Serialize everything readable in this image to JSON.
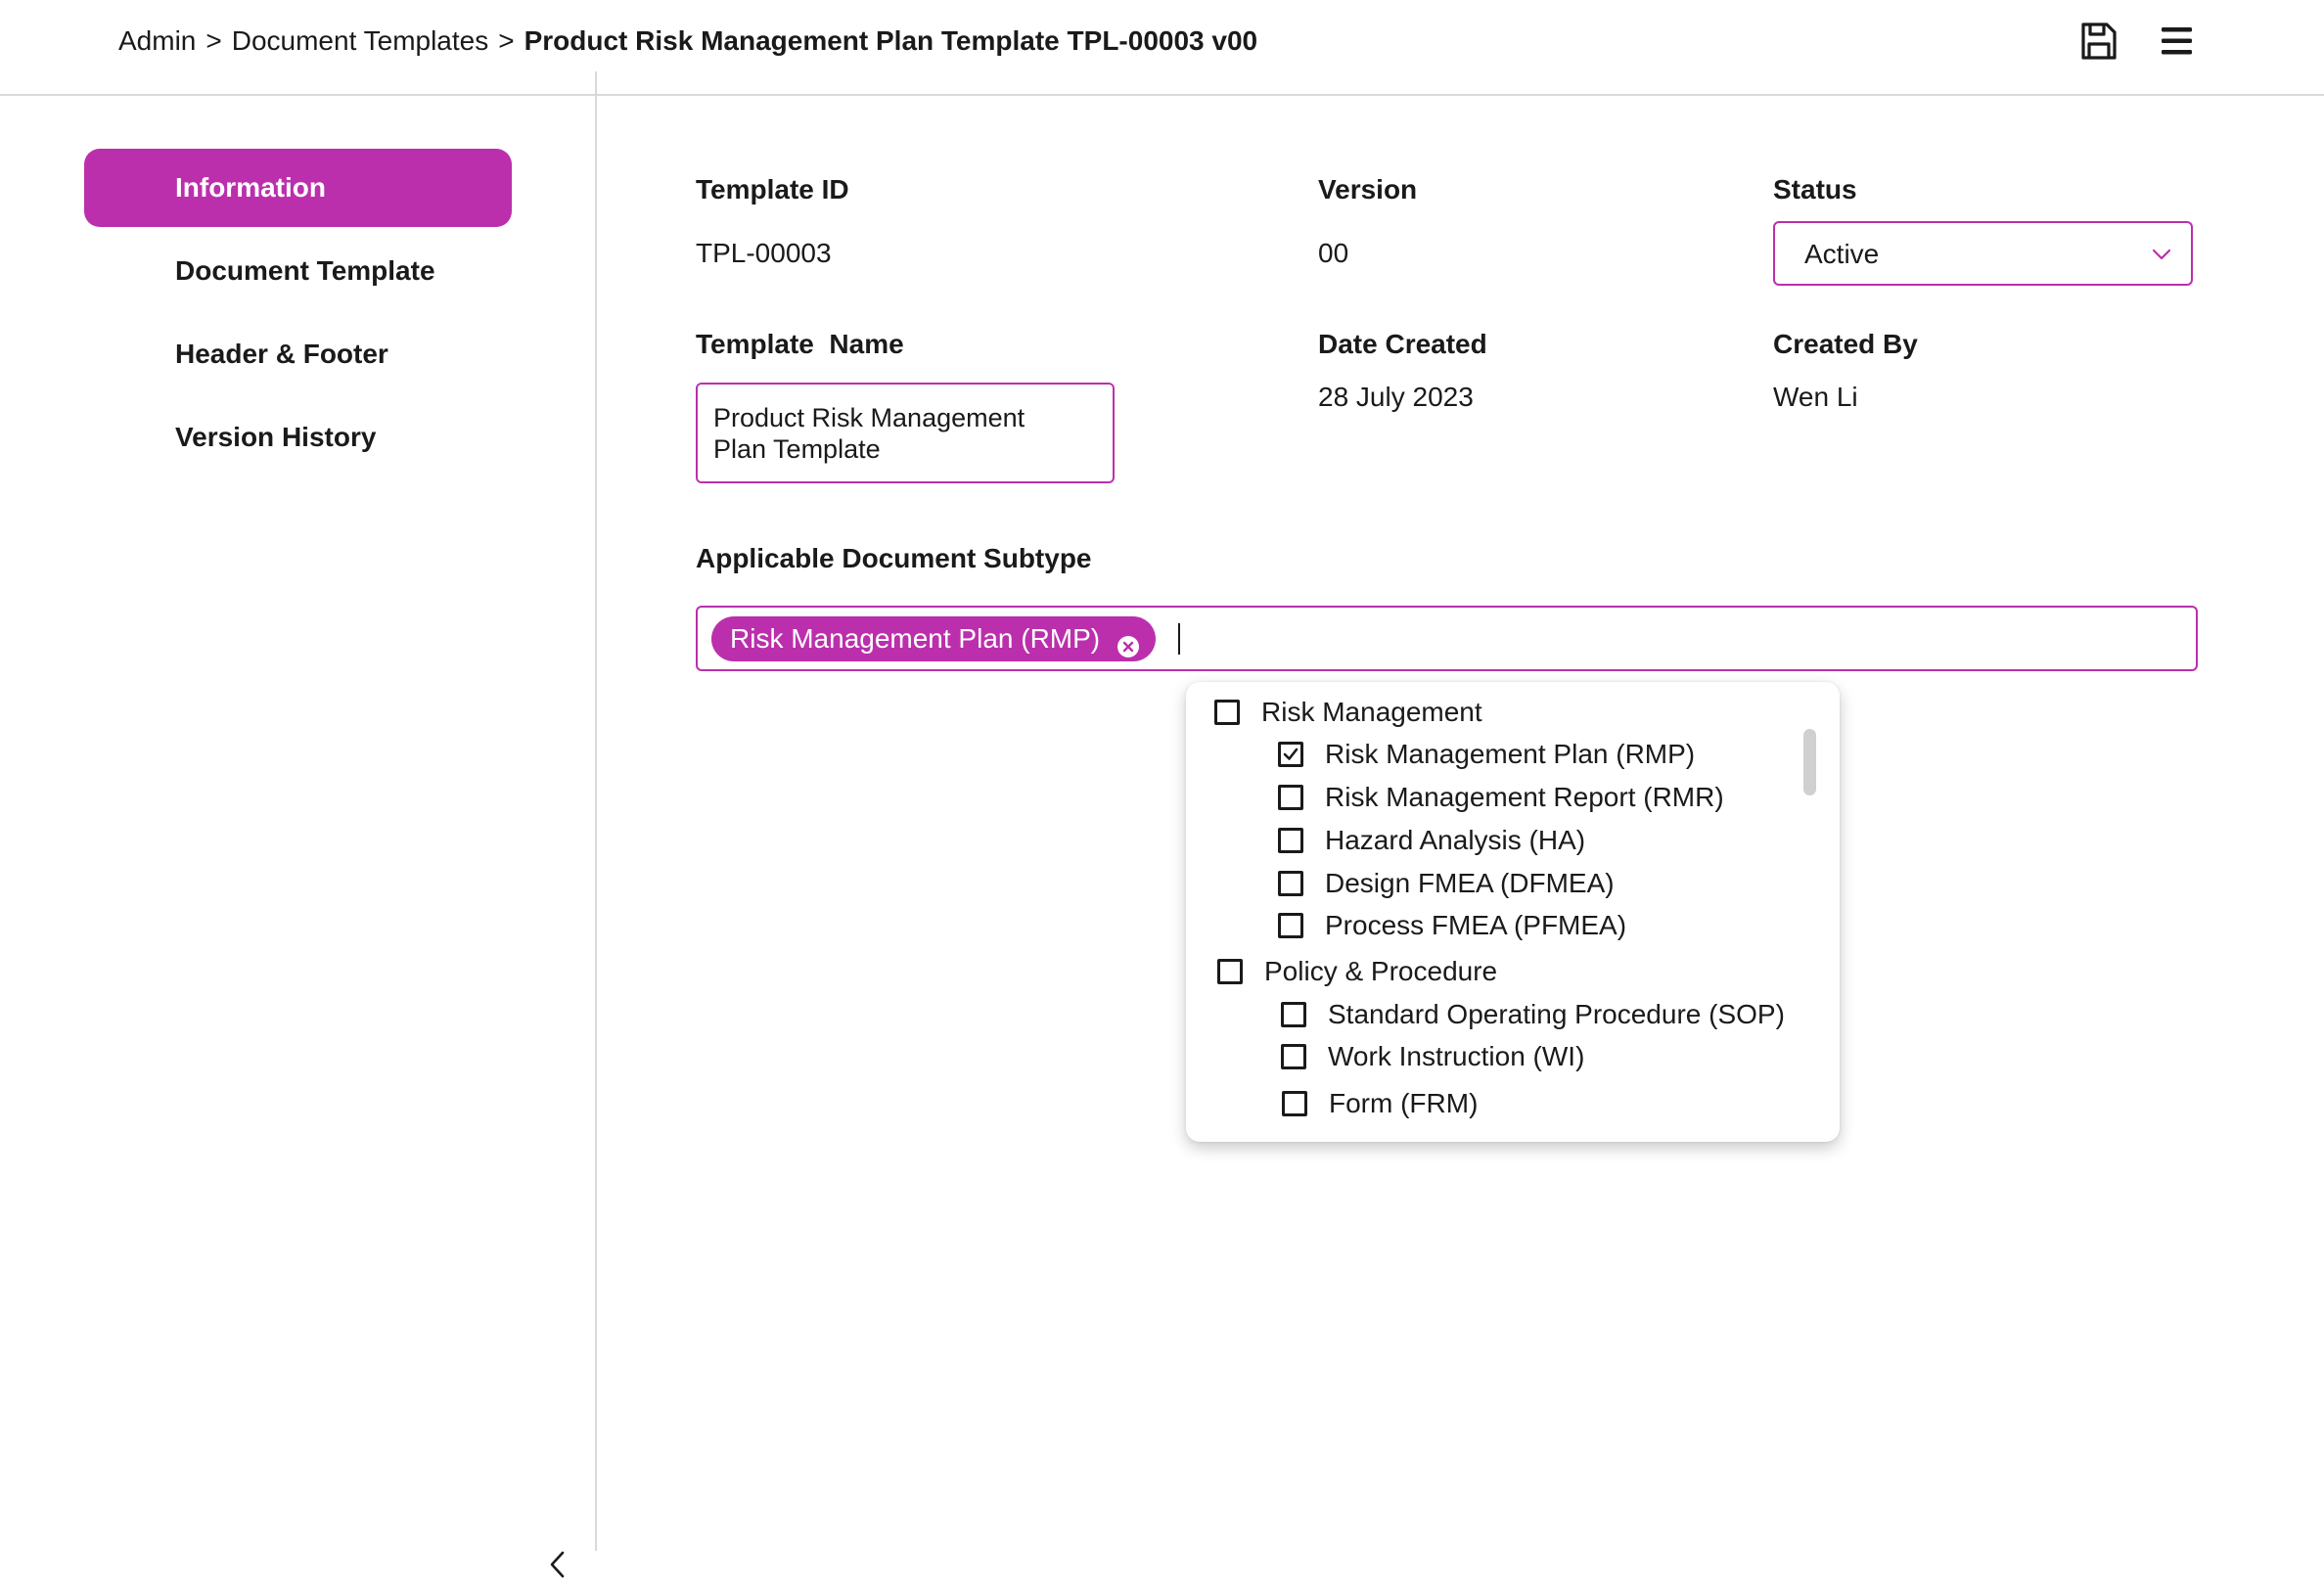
{
  "breadcrumb": {
    "root": "Admin",
    "section": "Document Templates",
    "current": "Product Risk Management Plan Template TPL-00003 v00",
    "separator": ">"
  },
  "toolbar": {
    "save_icon": "save-icon",
    "menu_icon": "hamburger-menu-icon"
  },
  "sidebar": {
    "items": [
      {
        "label": "Information",
        "active": true
      },
      {
        "label": "Document Template",
        "active": false
      },
      {
        "label": "Header & Footer",
        "active": false
      },
      {
        "label": "Version History",
        "active": false
      }
    ],
    "collapse_icon": "chevron-left-icon"
  },
  "form": {
    "template_id_label": "Template ID",
    "template_id": "TPL-00003",
    "version_label": "Version",
    "version": "00",
    "status_label": "Status",
    "status": "Active",
    "template_name_label": "Template  Name",
    "template_name": "Product Risk Management\nPlan Template",
    "date_created_label": "Date Created",
    "date_created": "28 July 2023",
    "created_by_label": "Created By",
    "created_by": "Wen Li",
    "subtype_label": "Applicable Document Subtype",
    "selected_chips": [
      "Risk Management Plan (RMP)"
    ]
  },
  "dropdown": {
    "groups": [
      {
        "label": "Risk Management",
        "checked": false,
        "options": [
          {
            "label": "Risk Management Plan (RMP)",
            "checked": true
          },
          {
            "label": "Risk Management Report (RMR)",
            "checked": false
          },
          {
            "label": "Hazard Analysis (HA)",
            "checked": false
          },
          {
            "label": "Design FMEA (DFMEA)",
            "checked": false
          },
          {
            "label": "Process FMEA (PFMEA)",
            "checked": false
          }
        ]
      },
      {
        "label": "Policy & Procedure",
        "checked": false,
        "options": [
          {
            "label": "Standard Operating Procedure (SOP)",
            "checked": false
          },
          {
            "label": "Work Instruction (WI)",
            "checked": false
          },
          {
            "label": "Form (FRM)",
            "checked": false
          }
        ]
      }
    ]
  },
  "colors": {
    "accent": "#bb2fac",
    "border": "#d9d9d9",
    "text": "#1a1a1a"
  }
}
